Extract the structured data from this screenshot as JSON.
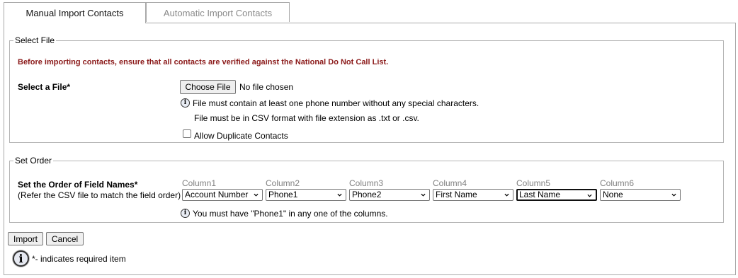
{
  "tabs": [
    {
      "label": "Manual Import Contacts",
      "active": true
    },
    {
      "label": "Automatic Import Contacts",
      "active": false
    }
  ],
  "select_file": {
    "legend": "Select File",
    "warning": "Before importing contacts, ensure that all contacts are verified against the National Do Not Call List.",
    "file_label": "Select a File*",
    "choose_button": "Choose File",
    "file_status": "No file chosen",
    "info_line1": "File must contain at least one phone number without any special characters.",
    "info_line2": "File must be in CSV format with file extension as .txt or .csv.",
    "allow_duplicates_label": "Allow Duplicate Contacts",
    "allow_duplicates_checked": false
  },
  "set_order": {
    "legend": "Set Order",
    "label": "Set the Order of Field Names*",
    "sublabel": "(Refer the CSV file to match the field order)",
    "columns": [
      {
        "header": "Column1",
        "value": "Account Number"
      },
      {
        "header": "Column2",
        "value": "Phone1"
      },
      {
        "header": "Column3",
        "value": "Phone2"
      },
      {
        "header": "Column4",
        "value": "First Name"
      },
      {
        "header": "Column5",
        "value": "Last Name"
      },
      {
        "header": "Column6",
        "value": "None"
      }
    ],
    "info": "You must have \"Phone1\" in any one of the columns."
  },
  "actions": {
    "import_label": "Import",
    "cancel_label": "Cancel"
  },
  "footer_note": "*- indicates required item",
  "icons": {
    "info": "info-icon",
    "dropdown": "chevron-down-icon"
  },
  "colors": {
    "warning": "#8b1a1a",
    "border": "#a9a9a9",
    "inactive_tab_text": "#8a8a8a"
  }
}
